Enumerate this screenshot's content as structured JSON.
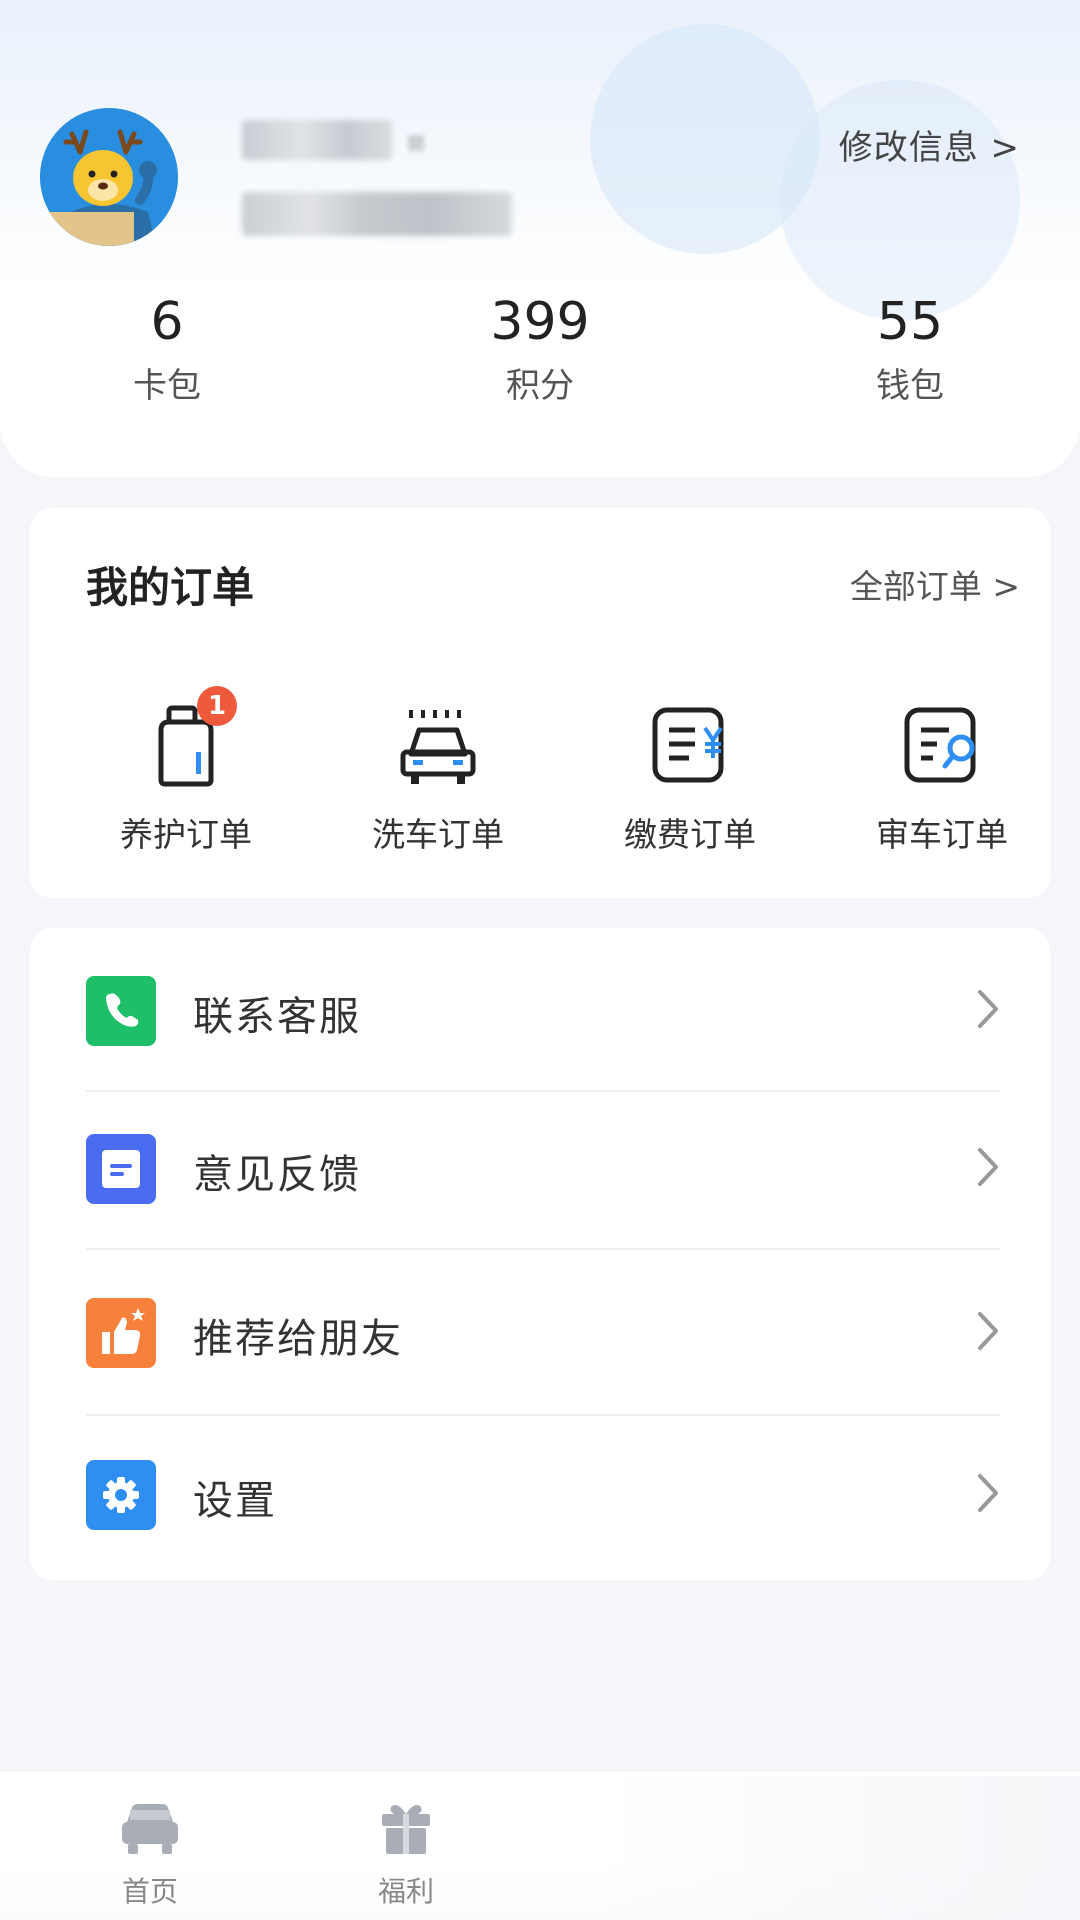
{
  "profile": {
    "edit_label": "修改信息 >",
    "stats": [
      {
        "value": "6",
        "label": "卡包"
      },
      {
        "value": "399",
        "label": "积分"
      },
      {
        "value": "55",
        "label": "钱包"
      }
    ]
  },
  "orders": {
    "title": "我的订单",
    "all_label": "全部订单 >",
    "items": [
      {
        "label": "养护订单",
        "icon": "maintenance-bottle-icon",
        "badge": "1"
      },
      {
        "label": "洗车订单",
        "icon": "car-wash-icon"
      },
      {
        "label": "缴费订单",
        "icon": "payment-receipt-icon"
      },
      {
        "label": "审车订单",
        "icon": "inspection-search-icon"
      }
    ]
  },
  "menu": {
    "items": [
      {
        "label": "联系客服",
        "icon": "phone-icon",
        "color": "#1fbf6a"
      },
      {
        "label": "意见反馈",
        "icon": "feedback-icon",
        "color": "#4a6cf0"
      },
      {
        "label": "推荐给朋友",
        "icon": "thumbs-up-icon",
        "color": "#f7813a"
      },
      {
        "label": "设置",
        "icon": "gear-icon",
        "color": "#2f8ef2"
      }
    ]
  },
  "nav": {
    "items": [
      {
        "label": "首页",
        "icon": "car-icon"
      },
      {
        "label": "福利",
        "icon": "gift-icon"
      }
    ]
  },
  "colors": {
    "accent_blue": "#2f8ef2",
    "badge_red": "#f05a3c",
    "background": "#f4f6f9"
  }
}
